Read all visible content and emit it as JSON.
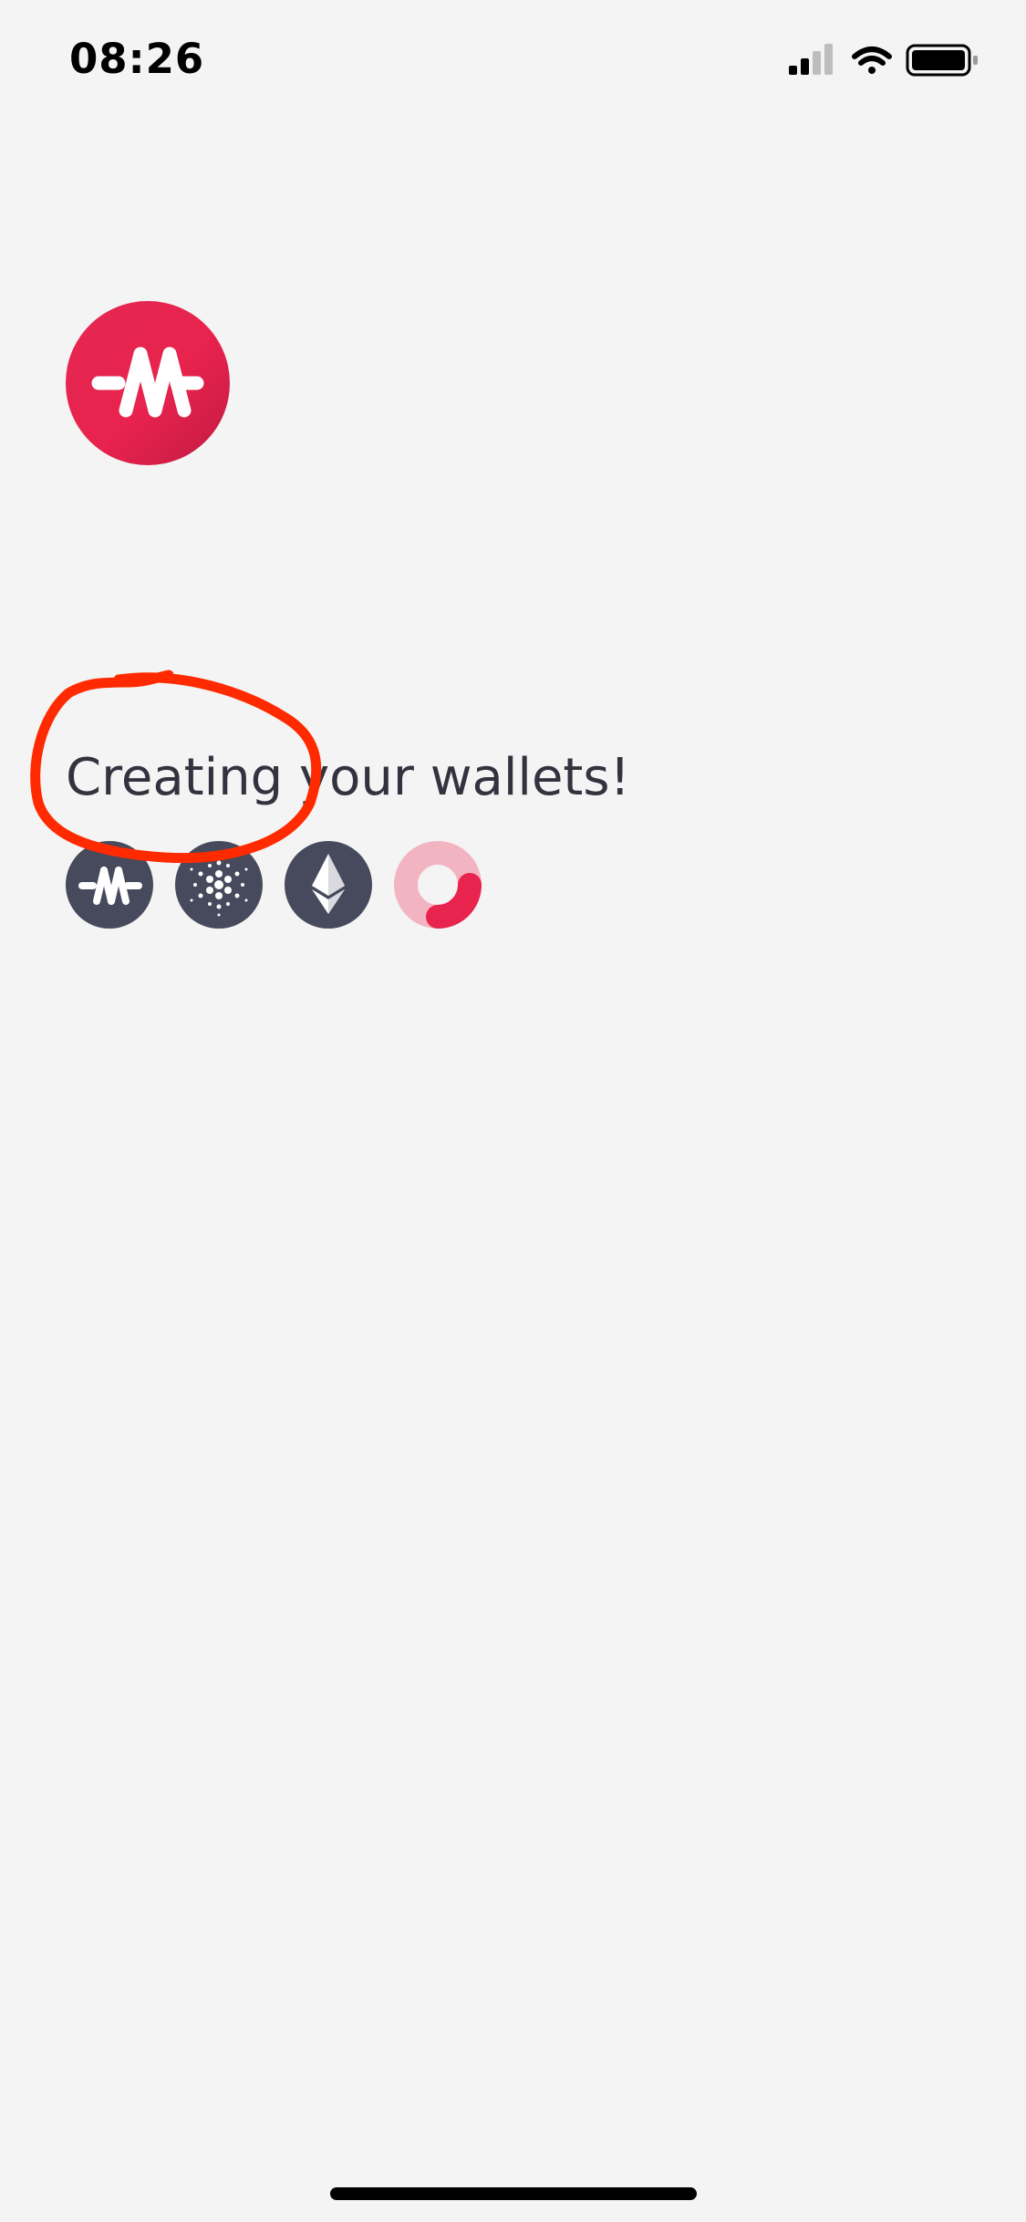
{
  "status_bar": {
    "time": "08:26",
    "icons": [
      "cellular-signal-icon",
      "wifi-icon",
      "battery-icon"
    ]
  },
  "app": {
    "logo_icon": "m-logo-icon",
    "brand_color": "#e8234d"
  },
  "main": {
    "heading": "Creating your wallets!",
    "wallets": [
      {
        "icon": "m-logo-icon",
        "status": "done"
      },
      {
        "icon": "cardano-icon",
        "status": "done"
      },
      {
        "icon": "ethereum-icon",
        "status": "done"
      },
      {
        "icon": "loading-spinner-icon",
        "status": "in-progress"
      }
    ]
  },
  "annotation": {
    "color": "#ff2a00",
    "shape": "red hand-drawn circle"
  }
}
